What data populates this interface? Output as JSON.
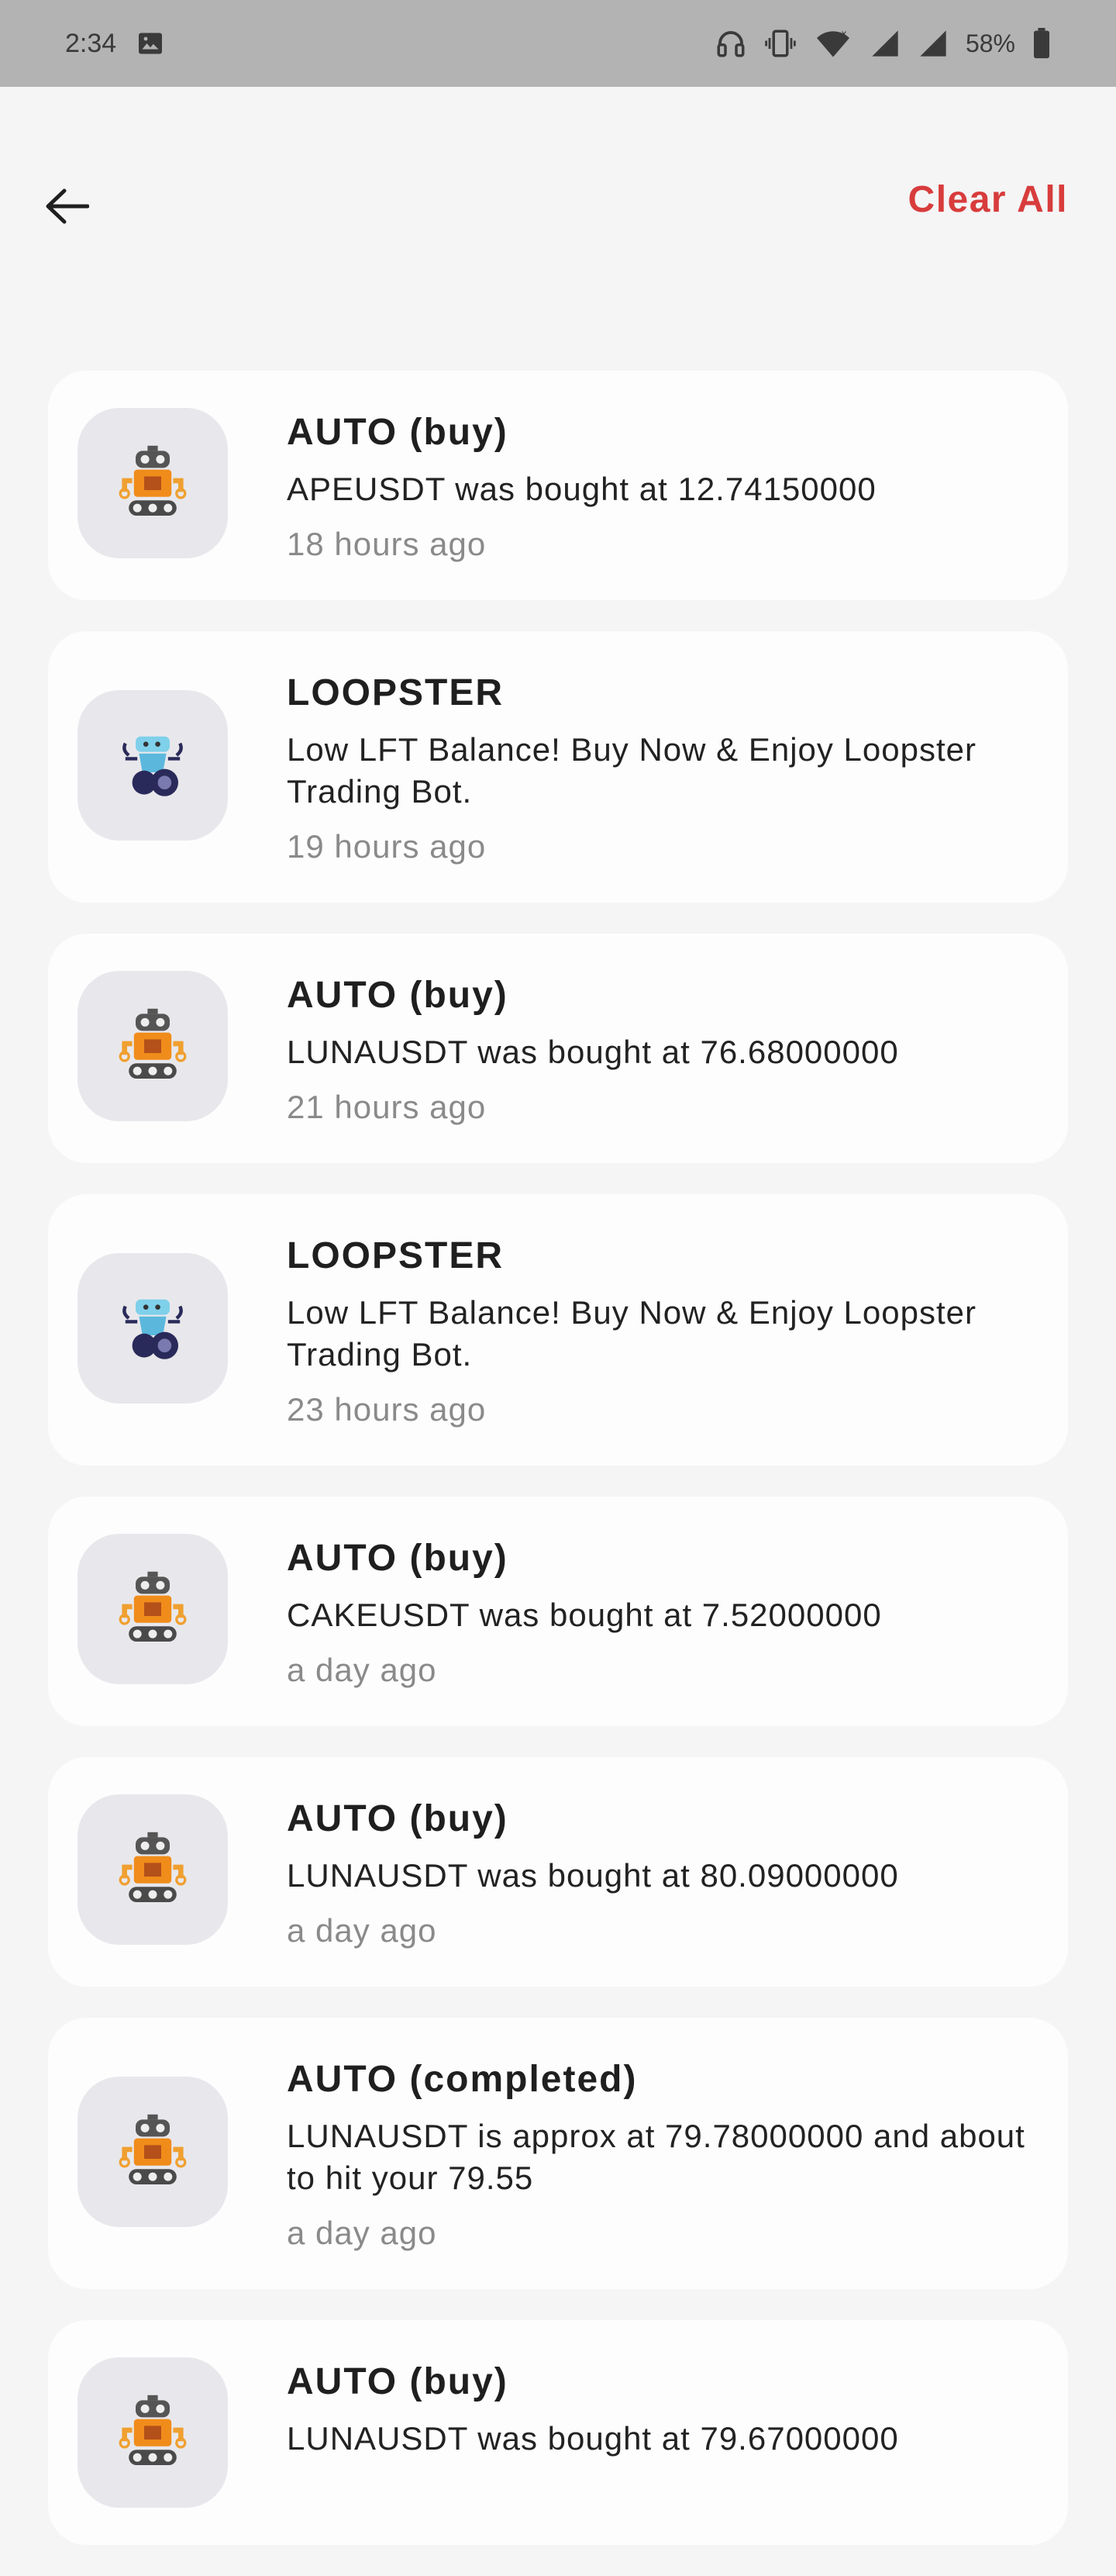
{
  "status_bar": {
    "time": "2:34",
    "battery": "58%",
    "icons": [
      "image-icon",
      "headphones-icon",
      "vibrate-icon",
      "wifi-icon",
      "signal-icon",
      "signal-icon",
      "battery-icon"
    ]
  },
  "header": {
    "back_icon": "arrow-left-icon",
    "clear_all_label": "Clear All",
    "accent_color": "#d83c3c"
  },
  "notifications": [
    {
      "type": "auto",
      "icon": "orange-robot-icon",
      "title": "AUTO (buy)",
      "body": "APEUSDT was bought at 12.74150000",
      "time": "18 hours ago"
    },
    {
      "type": "loopster",
      "icon": "blue-robot-icon",
      "title": "LOOPSTER",
      "body": "Low LFT Balance! Buy Now & Enjoy Loopster Trading Bot.",
      "time": "19 hours ago"
    },
    {
      "type": "auto",
      "icon": "orange-robot-icon",
      "title": "AUTO (buy)",
      "body": "LUNAUSDT was bought at 76.68000000",
      "time": "21 hours ago"
    },
    {
      "type": "loopster",
      "icon": "blue-robot-icon",
      "title": "LOOPSTER",
      "body": "Low LFT Balance! Buy Now & Enjoy Loopster Trading Bot.",
      "time": "23 hours ago"
    },
    {
      "type": "auto",
      "icon": "orange-robot-icon",
      "title": "AUTO (buy)",
      "body": "CAKEUSDT was bought at 7.52000000",
      "time": "a day ago"
    },
    {
      "type": "auto",
      "icon": "orange-robot-icon",
      "title": "AUTO (buy)",
      "body": "LUNAUSDT was bought at 80.09000000",
      "time": "a day ago"
    },
    {
      "type": "auto",
      "icon": "orange-robot-icon",
      "title": "AUTO (completed)",
      "body": "LUNAUSDT is approx at 79.78000000  and about to hit your 79.55",
      "time": "a day ago"
    },
    {
      "type": "auto",
      "icon": "orange-robot-icon",
      "title": "AUTO (buy)",
      "body": "LUNAUSDT was bought at 79.67000000",
      "time": ""
    }
  ]
}
